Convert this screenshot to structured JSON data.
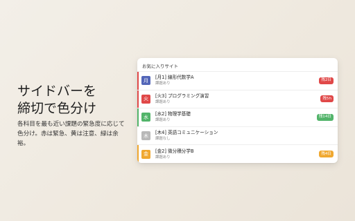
{
  "headline": {
    "line1": "サイドバーを",
    "line2": "締切で色分け"
  },
  "description": "各科目を最も近い課題の緊急度に応じて色分け。赤は緊急、黄は注意、緑は余裕。",
  "panel": {
    "title": "お気に入りサイト",
    "items": [
      {
        "day": "月",
        "name": "[月1] 線形代数学A",
        "status": "課題あり",
        "badge": "残2日",
        "stripe": "#e04848",
        "tile": "#5366b8",
        "badgeColor": "#e04848"
      },
      {
        "day": "火",
        "name": "[火3] プログラミング演習",
        "status": "課題あり",
        "badge": "残5h",
        "stripe": "#e04848",
        "tile": "#e04848",
        "badgeColor": "#e04848"
      },
      {
        "day": "水",
        "name": "[水2] 物理学基礎",
        "status": "課題あり",
        "badge": "残14日",
        "stripe": "#52b46a",
        "tile": "#52b46a",
        "badgeColor": "#52b46a"
      },
      {
        "day": "木",
        "name": "[木4] 英語コミュニケーション",
        "status": "課題なし",
        "badge": "",
        "stripe": "#ffffff",
        "tile": "#b8b8b8",
        "badgeColor": ""
      },
      {
        "day": "金",
        "name": "[金2] 微分積分学B",
        "status": "課題あり",
        "badge": "残4日",
        "stripe": "#f0a830",
        "tile": "#f0a830",
        "badgeColor": "#f0a830"
      }
    ]
  }
}
